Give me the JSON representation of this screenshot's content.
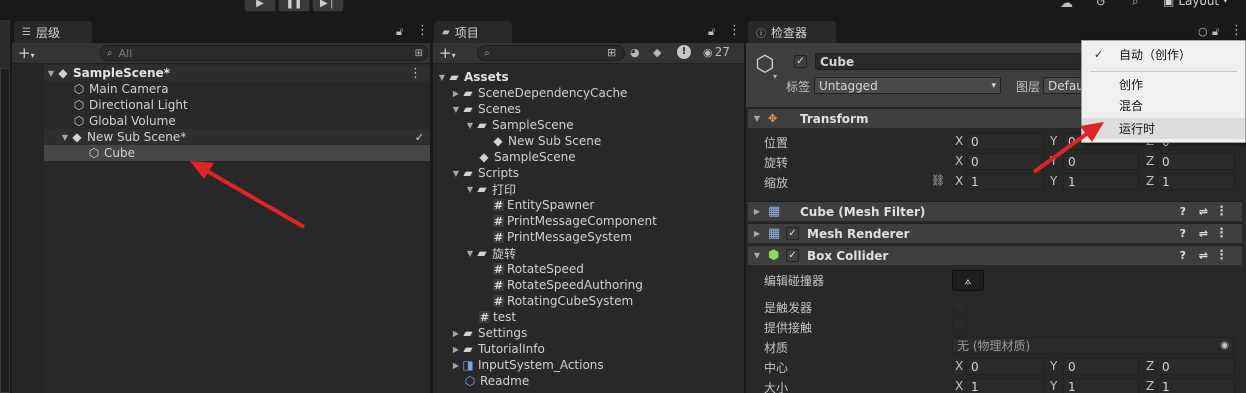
{
  "toolbar": {
    "play_icon": "play-icon",
    "pause_icon": "pause-icon",
    "step_icon": "step-icon",
    "layout_label": "Layout"
  },
  "hierarchy": {
    "tab_label": "层级",
    "search_placeholder": "All",
    "items": [
      {
        "label": "SampleScene*"
      },
      {
        "label": "Main Camera"
      },
      {
        "label": "Directional Light"
      },
      {
        "label": "Global Volume"
      },
      {
        "label": "New Sub Scene*"
      },
      {
        "label": "Cube"
      }
    ]
  },
  "project": {
    "tab_label": "项目",
    "hidden_count": "27",
    "items": [
      {
        "label": "Assets"
      },
      {
        "label": "SceneDependencyCache"
      },
      {
        "label": "Scenes"
      },
      {
        "label": "SampleScene"
      },
      {
        "label": "New Sub Scene"
      },
      {
        "label": "SampleScene"
      },
      {
        "label": "Scripts"
      },
      {
        "label": "打印"
      },
      {
        "label": "EntitySpawner"
      },
      {
        "label": "PrintMessageComponent"
      },
      {
        "label": "PrintMessageSystem"
      },
      {
        "label": "旋转"
      },
      {
        "label": "RotateSpeed"
      },
      {
        "label": "RotateSpeedAuthoring"
      },
      {
        "label": "RotatingCubeSystem"
      },
      {
        "label": "test"
      },
      {
        "label": "Settings"
      },
      {
        "label": "TutorialInfo"
      },
      {
        "label": "InputSystem_Actions"
      },
      {
        "label": "Readme"
      }
    ]
  },
  "inspector": {
    "tab_label": "检查器",
    "object_name": "Cube",
    "tag_label": "标签",
    "tag_value": "Untagged",
    "layer_label": "图层",
    "layer_value": "Defau",
    "transform": {
      "title": "Transform",
      "position_label": "位置",
      "rotation_label": "旋转",
      "scale_label": "缩放",
      "position": {
        "x": "0",
        "y": "0",
        "z": "0"
      },
      "rotation": {
        "x": "0",
        "y": "0",
        "z": "0"
      },
      "scale": {
        "x": "1",
        "y": "1",
        "z": "1"
      }
    },
    "mesh_filter_title": "Cube (Mesh Filter)",
    "mesh_renderer_title": "Mesh Renderer",
    "box_collider": {
      "title": "Box Collider",
      "edit_collider_label": "编辑碰撞器",
      "is_trigger_label": "是触发器",
      "provides_contacts_label": "提供接触",
      "material_label": "材质",
      "material_value": "无 (物理材质)",
      "center_label": "中心",
      "size_label": "大小",
      "center": {
        "x": "0",
        "y": "0",
        "z": "0"
      },
      "size": {
        "x": "1",
        "y": "1",
        "z": "1"
      }
    },
    "axis_labels": {
      "x": "X",
      "y": "Y",
      "z": "Z"
    }
  },
  "dropdown_menu": {
    "items": [
      {
        "label": "自动（创作）",
        "checked": true
      },
      {
        "label": "创作",
        "checked": false
      },
      {
        "label": "混合",
        "checked": false
      },
      {
        "label": "运行时",
        "checked": false
      }
    ]
  },
  "colors": {
    "annotation_arrow": "#e02424",
    "accent": "#4d78cc"
  }
}
